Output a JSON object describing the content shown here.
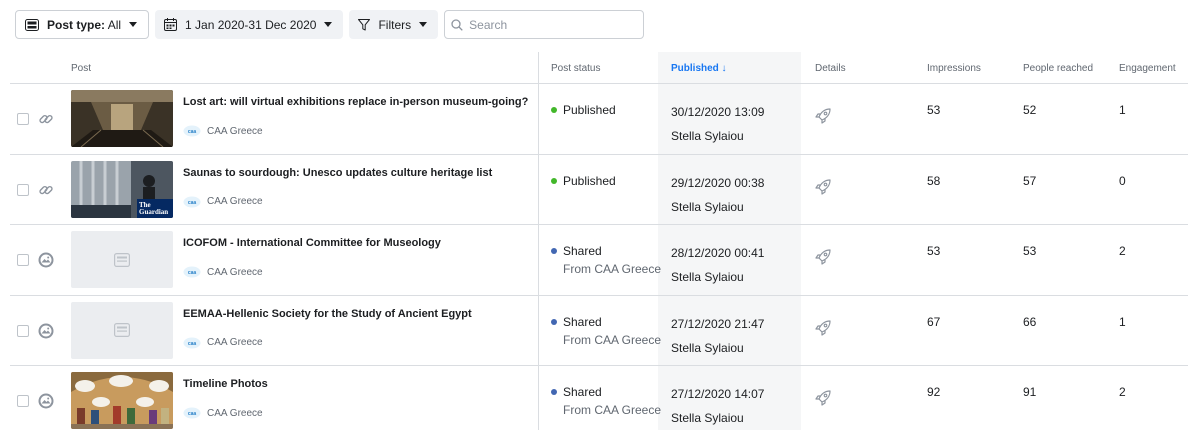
{
  "toolbar": {
    "post_type_prefix": "Post type:",
    "post_type_value": "All",
    "date_range": "1 Jan 2020-31 Dec 2020",
    "filters_label": "Filters",
    "search_placeholder": "Search"
  },
  "table": {
    "columns": {
      "post": "Post",
      "status": "Post status",
      "published": "Published ↓",
      "details": "Details",
      "impressions": "Impressions",
      "reached": "People reached",
      "engagement": "Engagement"
    },
    "rows": [
      {
        "type_icon": "link-icon",
        "thumbnail": "museum-photo",
        "title": "Lost art: will virtual exhibitions replace in-person museum-going? ...",
        "page": "CAA Greece",
        "status": "Published",
        "status_color": "#42b72a",
        "status_from": "",
        "date": "30/12/2020 13:09",
        "author": "Stella Sylaiou",
        "impressions": "53",
        "reached": "52",
        "engagement": "1"
      },
      {
        "type_icon": "link-icon",
        "thumbnail": "guardian-photo",
        "thumbnail_text": "The Guardian",
        "title": "Saunas to sourdough: Unesco updates culture heritage list",
        "page": "CAA Greece",
        "status": "Published",
        "status_color": "#42b72a",
        "status_from": "",
        "date": "29/12/2020 00:38",
        "author": "Stella Sylaiou",
        "impressions": "58",
        "reached": "57",
        "engagement": "0"
      },
      {
        "type_icon": "photo-icon",
        "thumbnail": "placeholder",
        "title": "ICOFOM - International Committee for Museology",
        "page": "CAA Greece",
        "status": "Shared",
        "status_color": "#4267b2",
        "status_from": "From CAA Greece",
        "date": "28/12/2020 00:41",
        "author": "Stella Sylaiou",
        "impressions": "53",
        "reached": "53",
        "engagement": "2"
      },
      {
        "type_icon": "photo-icon",
        "thumbnail": "placeholder",
        "title": "EEMAA-Hellenic Society for the Study of Ancient Egypt",
        "page": "CAA Greece",
        "status": "Shared",
        "status_color": "#4267b2",
        "status_from": "From CAA Greece",
        "date": "27/12/2020 21:47",
        "author": "Stella Sylaiou",
        "impressions": "67",
        "reached": "66",
        "engagement": "1"
      },
      {
        "type_icon": "photo-icon",
        "thumbnail": "painting-photo",
        "title": "Timeline Photos",
        "page": "CAA Greece",
        "status": "Shared",
        "status_color": "#4267b2",
        "status_from": "From CAA Greece",
        "date": "27/12/2020 14:07",
        "author": "Stella Sylaiou",
        "impressions": "92",
        "reached": "91",
        "engagement": "2"
      }
    ]
  },
  "colors": {
    "accent": "#1877f2",
    "published_dot": "#42b72a",
    "shared_dot": "#4267b2"
  }
}
